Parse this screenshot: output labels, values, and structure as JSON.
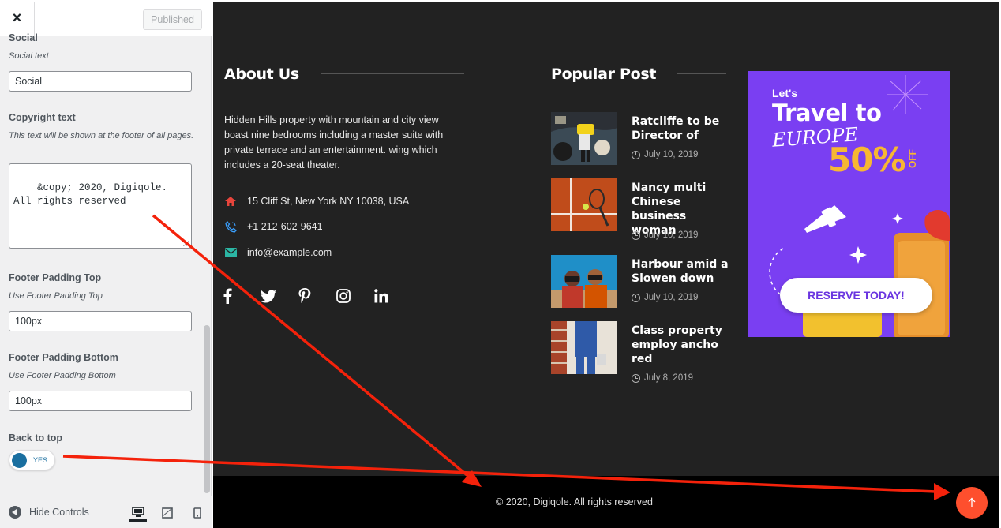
{
  "sidebar": {
    "close_label": "×",
    "published_label": "Published",
    "social": {
      "heading": "Social",
      "description": "Social text",
      "value": "Social"
    },
    "copyright": {
      "heading": "Copyright text",
      "description": "This text will be shown at the footer of all pages.",
      "value": "&copy; 2020, Digiqole. All rights reserved"
    },
    "padding_top": {
      "heading": "Footer Padding Top",
      "description": "Use Footer Padding Top",
      "value": "100px"
    },
    "padding_bottom": {
      "heading": "Footer Padding Bottom",
      "description": "Use Footer Padding Bottom",
      "value": "100px"
    },
    "back_to_top": {
      "heading": "Back to top",
      "toggle_text": "YES",
      "enabled": true
    },
    "footer": {
      "hide_controls_label": "Hide Controls",
      "devices": [
        "desktop-icon",
        "tablet-icon",
        "mobile-icon"
      ],
      "active_device": "desktop"
    },
    "colors": {
      "toggle_accent": "#1a6fa0"
    }
  },
  "preview": {
    "about": {
      "title": "About Us",
      "text": "Hidden Hills property with mountain and city view boast nine bedrooms including a master suite with private terrace and an entertainment. wing which includes a 20-seat theater.",
      "address": "15 Cliff St, New York NY 10038, USA",
      "phone": "+1 212-602-9641",
      "email": "info@example.com",
      "social_icons": [
        "facebook-icon",
        "twitter-icon",
        "pinterest-icon",
        "instagram-icon",
        "linkedin-icon"
      ]
    },
    "popular": {
      "title": "Popular Post",
      "posts": [
        {
          "title": "Ratcliffe to be Director of",
          "date": "July 10, 2019"
        },
        {
          "title": "Nancy multi Chinese business woman",
          "date": "July 10, 2019"
        },
        {
          "title": "Harbour amid a Slowen down",
          "date": "July 10, 2019"
        },
        {
          "title": "Class property employ ancho red",
          "date": "July 8, 2019"
        }
      ]
    },
    "ad": {
      "lets": "Let's",
      "travel": "Travel to",
      "europe": "EUROPE",
      "discount": "50%",
      "off": "OFF",
      "button": "RESERVE TODAY!"
    },
    "copyright": "© 2020, Digiqole. All rights reserved",
    "colors": {
      "footer_bg": "#222222",
      "bottom_bar_bg": "#000000",
      "back_to_top": "#fe4f2d",
      "address_icon": "#e8453c",
      "phone_icon": "#3aa0ff",
      "email_icon": "#2bb6a4",
      "annotation_arrow": "#f4220b"
    }
  }
}
